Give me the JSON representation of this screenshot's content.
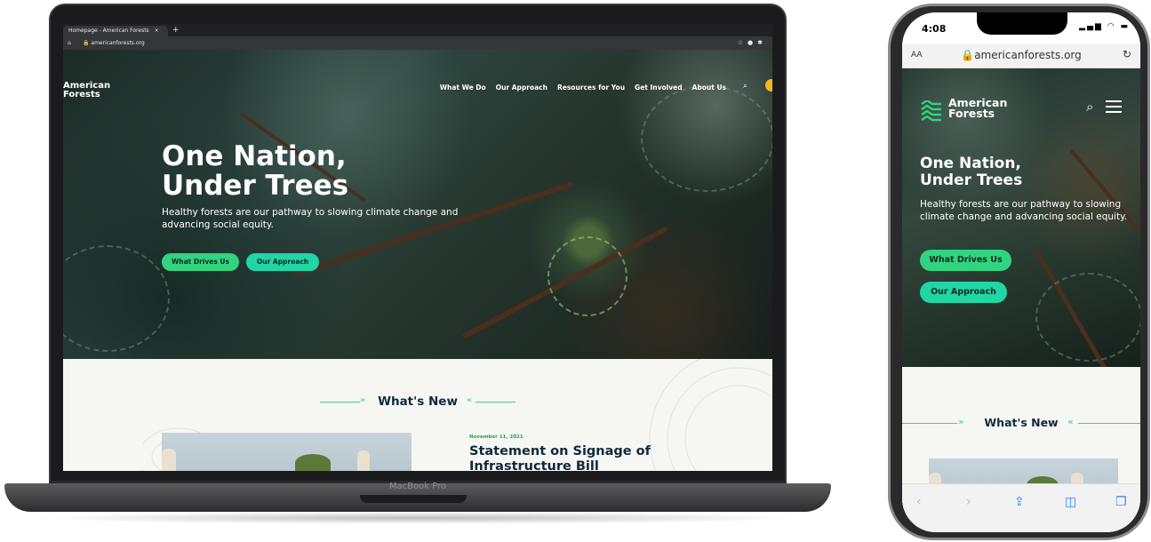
{
  "laptop": {
    "browser": {
      "tab_title": "Homepage - American Forests",
      "tab_close": "×",
      "new_tab": "+",
      "url": "americanforests.org"
    },
    "device_label": "MacBook Pro"
  },
  "site": {
    "logo_line1": "American",
    "logo_line2": "Forests",
    "nav": [
      "What We Do",
      "Our Approach",
      "Resources for You",
      "Get Involved",
      "About Us"
    ],
    "hero_title_line1": "One Nation,",
    "hero_title_line2": "Under Trees",
    "hero_subtitle": "Healthy forests are our pathway to slowing climate change and advancing social equity.",
    "cta_primary": "What Drives Us",
    "cta_secondary": "Our Approach",
    "section_heading": "What's New",
    "news_date": "November 11, 2021",
    "news_title": "Statement on Signage of Infrastructure Bill"
  },
  "phone": {
    "status_time": "4:08",
    "text_size_button": "AA",
    "url": "americanforests.org"
  },
  "icons": {
    "search": "search-icon",
    "menu": "hamburger-menu-icon",
    "reload": "reload-icon",
    "share": "share-icon",
    "bookmarks": "bookmarks-icon",
    "tabs": "tabs-icon",
    "back": "back-icon",
    "forward": "forward-icon"
  },
  "colors": {
    "cta_primary": "#31d47f",
    "cta_secondary": "#21d6a4",
    "heading_navy": "#0f2a3a",
    "accent_green": "#3ccf8a",
    "donate_yellow": "#f4b71d"
  }
}
